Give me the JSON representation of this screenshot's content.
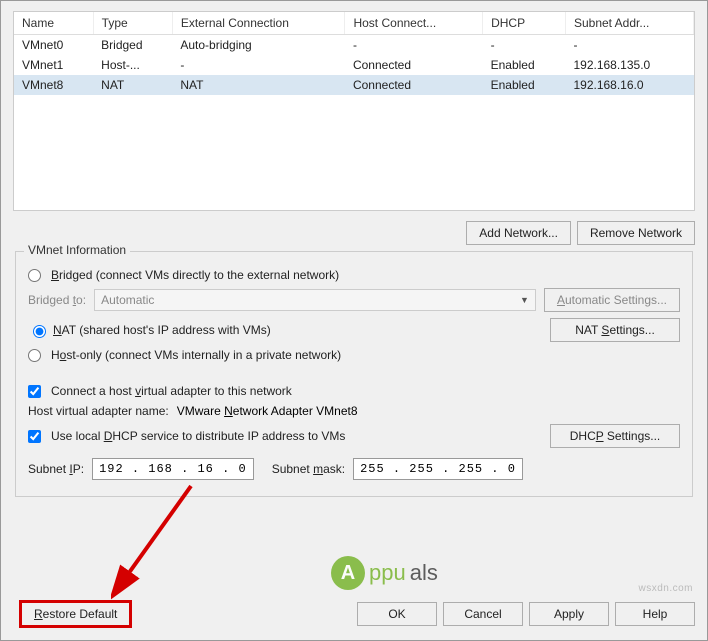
{
  "table": {
    "headers": [
      "Name",
      "Type",
      "External Connection",
      "Host Connect...",
      "DHCP",
      "Subnet Addr..."
    ],
    "rows": [
      {
        "name": "VMnet0",
        "type": "Bridged",
        "ext": "Auto-bridging",
        "host": "-",
        "dhcp": "-",
        "subnet": "-",
        "selected": false
      },
      {
        "name": "VMnet1",
        "type": "Host-...",
        "ext": "-",
        "host": "Connected",
        "dhcp": "Enabled",
        "subnet": "192.168.135.0",
        "selected": false
      },
      {
        "name": "VMnet8",
        "type": "NAT",
        "ext": "NAT",
        "host": "Connected",
        "dhcp": "Enabled",
        "subnet": "192.168.16.0",
        "selected": true
      }
    ]
  },
  "buttons": {
    "add_network": "Add Network...",
    "remove_network": "Remove Network",
    "automatic_settings": "Automatic Settings...",
    "nat_settings": "NAT Settings...",
    "dhcp_settings": "DHCP Settings...",
    "restore_default": "Restore Default",
    "ok": "OK",
    "cancel": "Cancel",
    "apply": "Apply",
    "help": "Help"
  },
  "group": {
    "title": "VMnet Information",
    "bridged_label": "Bridged (connect VMs directly to the external network)",
    "bridged_to_label": "Bridged to:",
    "bridged_to_value": "Automatic",
    "nat_label": "NAT (shared host's IP address with VMs)",
    "hostonly_label": "Host-only (connect VMs internally in a private network)",
    "connect_host_label": "Connect a host virtual adapter to this network",
    "host_adapter_name_label": "Host virtual adapter name:",
    "host_adapter_name_value": "VMware Network Adapter VMnet8",
    "dhcp_label": "Use local DHCP service to distribute IP address to VMs",
    "subnet_ip_label": "Subnet IP:",
    "subnet_ip_value": "192 . 168 . 16 . 0",
    "subnet_mask_label": "Subnet mask:",
    "subnet_mask_value": "255 . 255 . 255 . 0"
  },
  "watermark": {
    "a": "A",
    "t1": "ppu",
    "t2": "als",
    "src": "wsxdn.com"
  }
}
